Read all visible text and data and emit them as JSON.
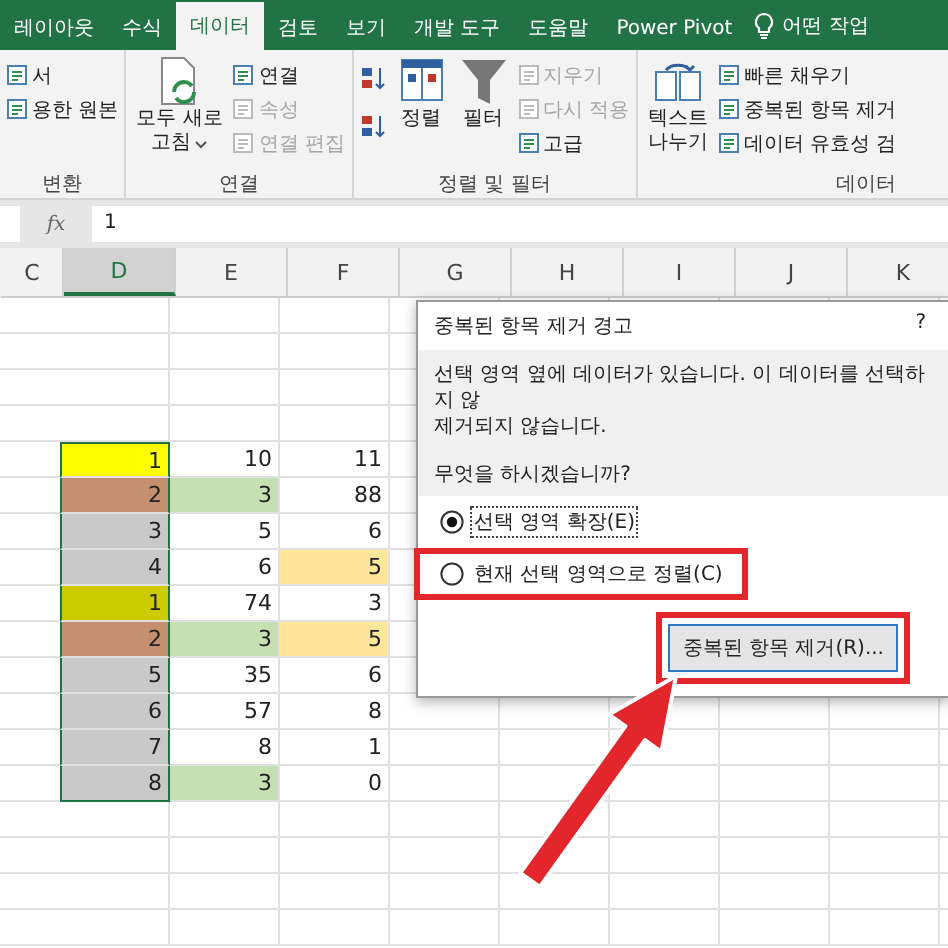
{
  "tabs": [
    {
      "label": "레이아웃",
      "selected": false
    },
    {
      "label": "수식",
      "selected": false
    },
    {
      "label": "데이터",
      "selected": true
    },
    {
      "label": "검토",
      "selected": false
    },
    {
      "label": "보기",
      "selected": false
    },
    {
      "label": "개발 도구",
      "selected": false
    },
    {
      "label": "도움말",
      "selected": false
    },
    {
      "label": "Power Pivot",
      "selected": false
    }
  ],
  "tell_me": "어떤 작업",
  "ribbon": {
    "groups": [
      {
        "label": "변환",
        "items": [
          {
            "kind": "stack",
            "commands": [
              {
                "label": "서",
                "disabled": false
              },
              {
                "label": "용한 원본",
                "disabled": false
              }
            ]
          }
        ]
      },
      {
        "label": "연결",
        "items": [
          {
            "kind": "large",
            "lines": [
              "모두 새로",
              "고침"
            ],
            "dropdown": true
          },
          {
            "kind": "stack",
            "commands": [
              {
                "label": "연결",
                "disabled": false
              },
              {
                "label": "속성",
                "disabled": true
              },
              {
                "label": "연결 편집",
                "disabled": true
              }
            ]
          }
        ]
      },
      {
        "label": "정렬 및 필터",
        "items": [
          {
            "kind": "sort"
          },
          {
            "kind": "large",
            "lines": [
              "정렬"
            ],
            "dropdown": false
          },
          {
            "kind": "large",
            "lines": [
              "필터"
            ],
            "dropdown": false
          },
          {
            "kind": "stack",
            "commands": [
              {
                "label": "지우기",
                "disabled": true
              },
              {
                "label": "다시 적용",
                "disabled": true
              },
              {
                "label": "고급",
                "disabled": false
              }
            ]
          }
        ]
      },
      {
        "label": "데이터",
        "items": [
          {
            "kind": "large",
            "lines": [
              "텍스트",
              "나누기"
            ],
            "dropdown": false
          },
          {
            "kind": "stack",
            "commands": [
              {
                "label": "빠른 채우기",
                "disabled": false
              },
              {
                "label": "중복된 항목 제거",
                "disabled": false
              },
              {
                "label": "데이터 유효성 검",
                "disabled": false
              }
            ]
          }
        ]
      }
    ]
  },
  "formula_bar": {
    "fx": "fx",
    "value": "1"
  },
  "columns": [
    {
      "label": "C",
      "selected": false
    },
    {
      "label": "D",
      "selected": true
    },
    {
      "label": "E",
      "selected": false
    },
    {
      "label": "F",
      "selected": false
    },
    {
      "label": "G",
      "selected": false
    },
    {
      "label": "H",
      "selected": false
    },
    {
      "label": "I",
      "selected": false
    },
    {
      "label": "J",
      "selected": false
    },
    {
      "label": "K",
      "selected": false
    }
  ],
  "rows": [
    [
      {
        "value": "1",
        "color": "#ffff00"
      },
      {
        "value": "10"
      },
      {
        "value": "11"
      }
    ],
    [
      {
        "value": "2",
        "color": "#c4906f"
      },
      {
        "value": "3",
        "color": "#c6e0b4"
      },
      {
        "value": "88"
      }
    ],
    [
      {
        "value": "3",
        "color": "#c9c9c9"
      },
      {
        "value": "5"
      },
      {
        "value": "6"
      }
    ],
    [
      {
        "value": "4",
        "color": "#c9c9c9"
      },
      {
        "value": "6"
      },
      {
        "value": "5",
        "color": "#ffe699"
      }
    ],
    [
      {
        "value": "1",
        "color": "#cccc00"
      },
      {
        "value": "74"
      },
      {
        "value": "3"
      }
    ],
    [
      {
        "value": "2",
        "color": "#c4906f"
      },
      {
        "value": "3",
        "color": "#c6e0b4"
      },
      {
        "value": "5",
        "color": "#ffe699"
      }
    ],
    [
      {
        "value": "5",
        "color": "#c9c9c9"
      },
      {
        "value": "35"
      },
      {
        "value": "6"
      }
    ],
    [
      {
        "value": "6",
        "color": "#c9c9c9"
      },
      {
        "value": "57"
      },
      {
        "value": "8"
      }
    ],
    [
      {
        "value": "7",
        "color": "#c9c9c9"
      },
      {
        "value": "8"
      },
      {
        "value": "1"
      }
    ],
    [
      {
        "value": "8",
        "color": "#c9c9c9"
      },
      {
        "value": "3",
        "color": "#c6e0b4"
      },
      {
        "value": "0"
      }
    ]
  ],
  "dialog": {
    "title": "중복된 항목 제거 경고",
    "help": "?",
    "message_lines": [
      "선택 영역 옆에 데이터가 있습니다. 이 데이터를 선택하지 않",
      "제거되지 않습니다."
    ],
    "question": "무엇을 하시겠습니까?",
    "options": [
      {
        "label": "선택 영역 확장(E)",
        "selected": true,
        "highlighted": false
      },
      {
        "label": "현재 선택 영역으로 정렬(C)",
        "selected": false,
        "highlighted": true
      }
    ],
    "button": {
      "label": "중복된 항목 제거(R)...",
      "highlighted": true
    }
  }
}
